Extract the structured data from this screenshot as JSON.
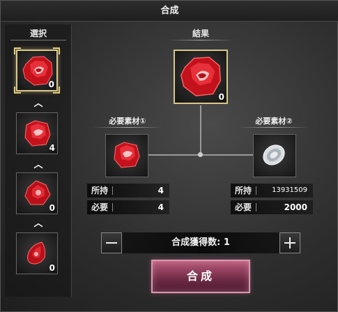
{
  "window": {
    "title": "合成"
  },
  "selection": {
    "header": "選択",
    "items": [
      {
        "icon": "red-gem-icon",
        "count": "0",
        "selected": true
      },
      {
        "icon": "red-gem-icon",
        "count": "4",
        "selected": false
      },
      {
        "icon": "red-gem-icon",
        "count": "0",
        "selected": false
      },
      {
        "icon": "red-gem-icon",
        "count": "0",
        "selected": false
      }
    ]
  },
  "result": {
    "label": "結果",
    "icon": "red-gem-icon",
    "count": "0"
  },
  "material1": {
    "label": "必要素材①",
    "icon": "red-gem-icon",
    "owned_label": "所持",
    "owned": "4",
    "required_label": "必要",
    "required": "4"
  },
  "material2": {
    "label": "必要素材②",
    "icon": "silver-coin-icon",
    "owned_label": "所持",
    "owned": "13931509",
    "required_label": "必要",
    "required": "2000"
  },
  "quantity": {
    "text": "合成獲得数: 1"
  },
  "synthesize_button": {
    "label": "合成"
  },
  "colors": {
    "accent_gold": "#d9c88a",
    "button_pink": "#b85a7a",
    "gem_red": "#d0121e"
  }
}
